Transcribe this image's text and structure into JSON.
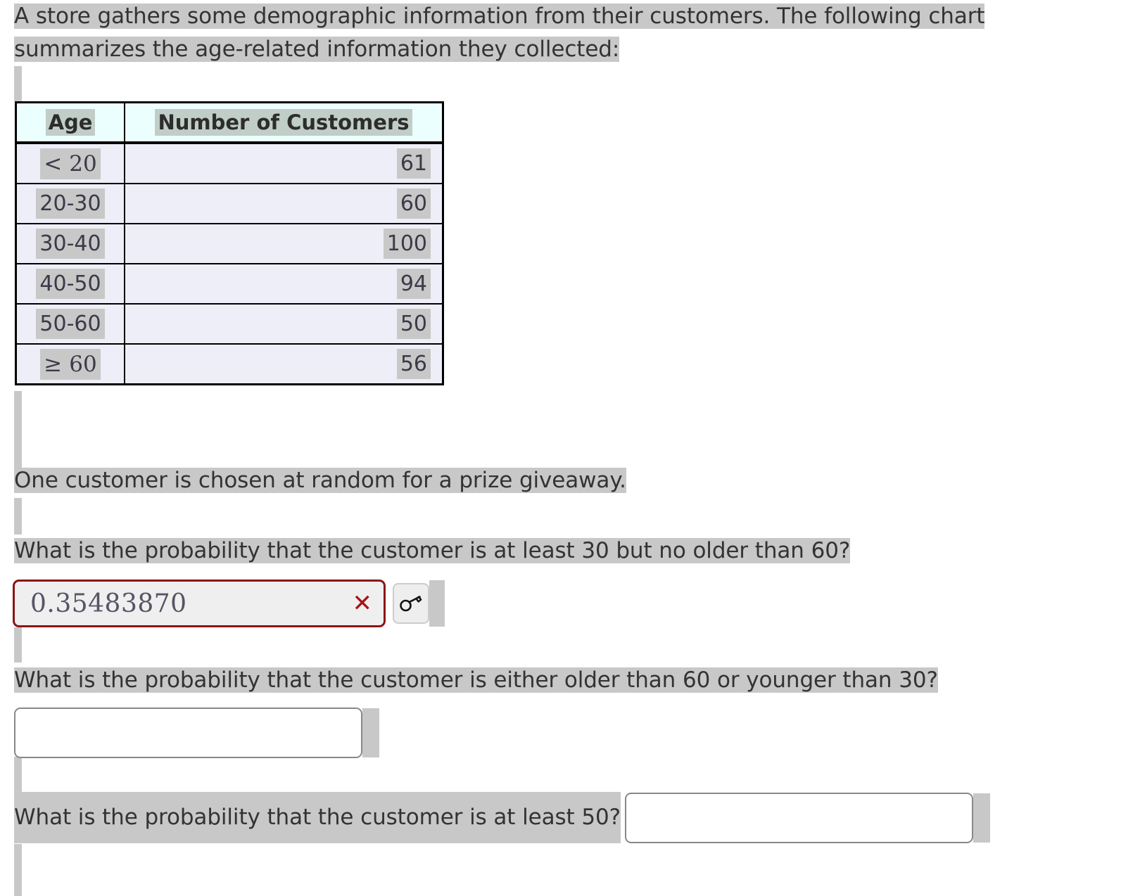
{
  "intro": {
    "line1": "A store gathers some demographic information from their customers. The following chart",
    "line2": "summarizes the age-related information they collected:"
  },
  "chart_data": {
    "type": "table",
    "title": "",
    "columns": [
      "Age",
      "Number of Customers"
    ],
    "categories": [
      "< 20",
      "20-30",
      "30-40",
      "40-50",
      "50-60",
      "≥ 60"
    ],
    "values": [
      61,
      60,
      100,
      94,
      50,
      56
    ],
    "xlabel": "Age",
    "ylabel": "Number of Customers",
    "rows": [
      {
        "age_rel": "<",
        "age_num": "20",
        "age_plain": "< 20",
        "count": "61"
      },
      {
        "age_rel": "",
        "age_num": "20-30",
        "age_plain": "20-30",
        "count": "60"
      },
      {
        "age_rel": "",
        "age_num": "30-40",
        "age_plain": "30-40",
        "count": "100"
      },
      {
        "age_rel": "",
        "age_num": "40-50",
        "age_plain": "40-50",
        "count": "94"
      },
      {
        "age_rel": "",
        "age_num": "50-60",
        "age_plain": "50-60",
        "count": "50"
      },
      {
        "age_rel": "≥",
        "age_num": "60",
        "age_plain": "≥ 60",
        "count": "56"
      }
    ]
  },
  "table": {
    "header_age": "Age",
    "header_count": "Number of Customers"
  },
  "prompt": {
    "setup": "One customer is chosen at random for a prize giveaway."
  },
  "questions": [
    {
      "text": "What is the probability that the customer is at least 30 but no older than 60?",
      "answer_value": "0.35483870",
      "status": "incorrect",
      "status_glyph": "✕",
      "key_button_name": "key-icon"
    },
    {
      "text": "What is the probability that the customer is either older than 60 or younger than 30?",
      "answer_value": "",
      "status": "empty"
    },
    {
      "text": "What is the probability that the customer is at least 50?",
      "answer_value": "",
      "status": "empty"
    }
  ],
  "colors": {
    "selection": "#c8c8c8",
    "header_cell_bg": "#ecffff",
    "data_cell_bg": "#eeeef8",
    "incorrect_border": "#8b1515",
    "incorrect_mark": "#a81414",
    "text": "#333333"
  }
}
